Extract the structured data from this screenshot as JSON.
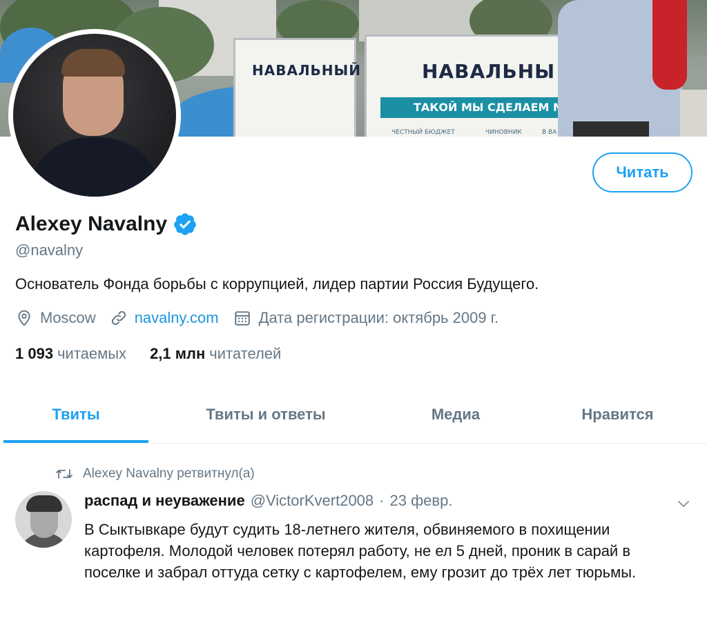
{
  "banner": {
    "panel_left_text": "НАВАЛЬНЫЙ",
    "panel_right_text": "НАВАЛЬНЫ",
    "panel_right_strip": "ТАКОЙ МЫ СДЕЛАЕМ МОСК",
    "panel_foot_1": "ЧЕСТНЫЙ БЮДЖЕТ",
    "panel_foot_2": "ЧИНОВНИК",
    "panel_foot_3": "В ВА"
  },
  "profile": {
    "name": "Alexey Navalny",
    "handle": "@navalny",
    "bio": "Основатель Фонда борьбы с коррупцией, лидер партии Россия Будущего.",
    "location": "Moscow",
    "website": "navalny.com",
    "joined": "Дата регистрации: октябрь 2009 г.",
    "following_count": "1 093",
    "following_label": "читаемых",
    "followers_count": "2,1 млн",
    "followers_label": "читателей",
    "follow_button": "Читать"
  },
  "tabs": [
    {
      "label": "Твиты",
      "active": true
    },
    {
      "label": "Твиты и ответы",
      "active": false
    },
    {
      "label": "Медиа",
      "active": false
    },
    {
      "label": "Нравится",
      "active": false
    }
  ],
  "tweet": {
    "retweet_label": "Alexey Navalny ретвитнул(а)",
    "author_name": "распад и неуважение",
    "author_handle": "@VictorKvert2008",
    "separator": "·",
    "date": "23 февр.",
    "text": "В Сыктывкаре будут судить 18-летнего жителя, обвиняемого в похищении картофеля. Молодой человек потерял работу, не ел 5 дней, проник в сарай в поселке и забрал оттуда сетку с картофелем, ему грозит до трёх лет тюрьмы."
  },
  "colors": {
    "accent": "#1da1f2",
    "link": "#1b95e0",
    "secondary_text": "#657786",
    "primary_text": "#14171a"
  },
  "icons": [
    "verified-badge-icon",
    "location-pin-icon",
    "link-icon",
    "calendar-icon",
    "retweet-icon",
    "chevron-down-icon"
  ]
}
